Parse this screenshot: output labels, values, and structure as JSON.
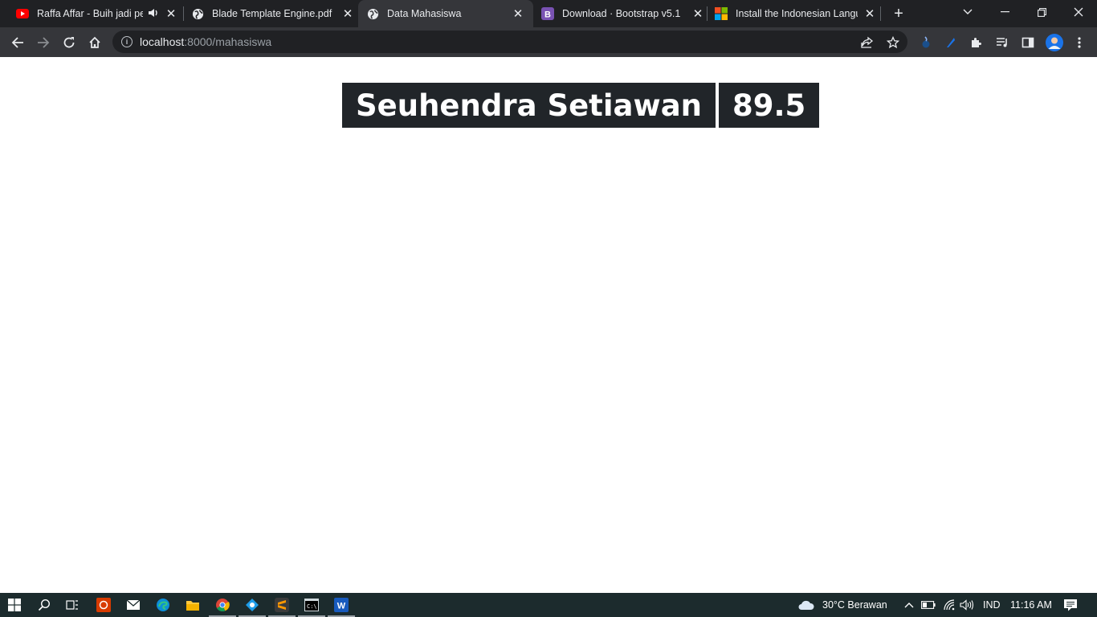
{
  "browser": {
    "tabs": [
      {
        "title": "Raffa Affar - Buih jadi per",
        "favicon": "youtube-icon",
        "audio": true
      },
      {
        "title": "Blade Template Engine.pdf",
        "favicon": "globe-icon"
      },
      {
        "title": "Data Mahasiswa",
        "favicon": "globe-icon",
        "active": true
      },
      {
        "title": "Download · Bootstrap v5.1",
        "favicon": "bootstrap-icon"
      },
      {
        "title": "Install the Indonesian Langua",
        "favicon": "microsoft-icon"
      }
    ],
    "address": {
      "host": "localhost",
      "rest": ":8000/mahasiswa"
    },
    "colors": {
      "frame": "#202124",
      "toolbar": "#35363a"
    }
  },
  "page": {
    "student_name": "Seuhendra Setiawan",
    "student_score": "89.5",
    "cell_color": "#212529"
  },
  "taskbar": {
    "weather": "30°C  Berawan",
    "language": "IND",
    "time": "11:16 AM"
  }
}
